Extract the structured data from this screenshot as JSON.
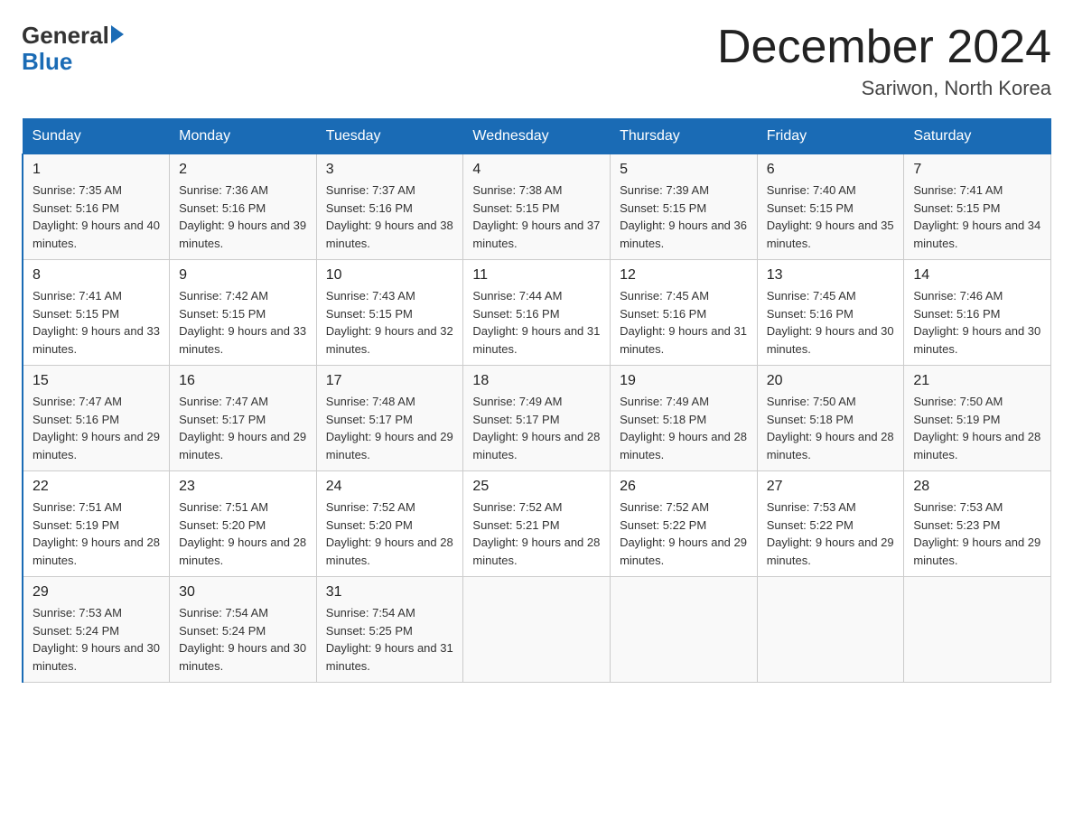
{
  "header": {
    "title": "December 2024",
    "location": "Sariwon, North Korea",
    "logo_general": "General",
    "logo_blue": "Blue"
  },
  "days_of_week": [
    "Sunday",
    "Monday",
    "Tuesday",
    "Wednesday",
    "Thursday",
    "Friday",
    "Saturday"
  ],
  "weeks": [
    [
      {
        "day": "1",
        "sunrise": "7:35 AM",
        "sunset": "5:16 PM",
        "daylight": "9 hours and 40 minutes."
      },
      {
        "day": "2",
        "sunrise": "7:36 AM",
        "sunset": "5:16 PM",
        "daylight": "9 hours and 39 minutes."
      },
      {
        "day": "3",
        "sunrise": "7:37 AM",
        "sunset": "5:16 PM",
        "daylight": "9 hours and 38 minutes."
      },
      {
        "day": "4",
        "sunrise": "7:38 AM",
        "sunset": "5:15 PM",
        "daylight": "9 hours and 37 minutes."
      },
      {
        "day": "5",
        "sunrise": "7:39 AM",
        "sunset": "5:15 PM",
        "daylight": "9 hours and 36 minutes."
      },
      {
        "day": "6",
        "sunrise": "7:40 AM",
        "sunset": "5:15 PM",
        "daylight": "9 hours and 35 minutes."
      },
      {
        "day": "7",
        "sunrise": "7:41 AM",
        "sunset": "5:15 PM",
        "daylight": "9 hours and 34 minutes."
      }
    ],
    [
      {
        "day": "8",
        "sunrise": "7:41 AM",
        "sunset": "5:15 PM",
        "daylight": "9 hours and 33 minutes."
      },
      {
        "day": "9",
        "sunrise": "7:42 AM",
        "sunset": "5:15 PM",
        "daylight": "9 hours and 33 minutes."
      },
      {
        "day": "10",
        "sunrise": "7:43 AM",
        "sunset": "5:15 PM",
        "daylight": "9 hours and 32 minutes."
      },
      {
        "day": "11",
        "sunrise": "7:44 AM",
        "sunset": "5:16 PM",
        "daylight": "9 hours and 31 minutes."
      },
      {
        "day": "12",
        "sunrise": "7:45 AM",
        "sunset": "5:16 PM",
        "daylight": "9 hours and 31 minutes."
      },
      {
        "day": "13",
        "sunrise": "7:45 AM",
        "sunset": "5:16 PM",
        "daylight": "9 hours and 30 minutes."
      },
      {
        "day": "14",
        "sunrise": "7:46 AM",
        "sunset": "5:16 PM",
        "daylight": "9 hours and 30 minutes."
      }
    ],
    [
      {
        "day": "15",
        "sunrise": "7:47 AM",
        "sunset": "5:16 PM",
        "daylight": "9 hours and 29 minutes."
      },
      {
        "day": "16",
        "sunrise": "7:47 AM",
        "sunset": "5:17 PM",
        "daylight": "9 hours and 29 minutes."
      },
      {
        "day": "17",
        "sunrise": "7:48 AM",
        "sunset": "5:17 PM",
        "daylight": "9 hours and 29 minutes."
      },
      {
        "day": "18",
        "sunrise": "7:49 AM",
        "sunset": "5:17 PM",
        "daylight": "9 hours and 28 minutes."
      },
      {
        "day": "19",
        "sunrise": "7:49 AM",
        "sunset": "5:18 PM",
        "daylight": "9 hours and 28 minutes."
      },
      {
        "day": "20",
        "sunrise": "7:50 AM",
        "sunset": "5:18 PM",
        "daylight": "9 hours and 28 minutes."
      },
      {
        "day": "21",
        "sunrise": "7:50 AM",
        "sunset": "5:19 PM",
        "daylight": "9 hours and 28 minutes."
      }
    ],
    [
      {
        "day": "22",
        "sunrise": "7:51 AM",
        "sunset": "5:19 PM",
        "daylight": "9 hours and 28 minutes."
      },
      {
        "day": "23",
        "sunrise": "7:51 AM",
        "sunset": "5:20 PM",
        "daylight": "9 hours and 28 minutes."
      },
      {
        "day": "24",
        "sunrise": "7:52 AM",
        "sunset": "5:20 PM",
        "daylight": "9 hours and 28 minutes."
      },
      {
        "day": "25",
        "sunrise": "7:52 AM",
        "sunset": "5:21 PM",
        "daylight": "9 hours and 28 minutes."
      },
      {
        "day": "26",
        "sunrise": "7:52 AM",
        "sunset": "5:22 PM",
        "daylight": "9 hours and 29 minutes."
      },
      {
        "day": "27",
        "sunrise": "7:53 AM",
        "sunset": "5:22 PM",
        "daylight": "9 hours and 29 minutes."
      },
      {
        "day": "28",
        "sunrise": "7:53 AM",
        "sunset": "5:23 PM",
        "daylight": "9 hours and 29 minutes."
      }
    ],
    [
      {
        "day": "29",
        "sunrise": "7:53 AM",
        "sunset": "5:24 PM",
        "daylight": "9 hours and 30 minutes."
      },
      {
        "day": "30",
        "sunrise": "7:54 AM",
        "sunset": "5:24 PM",
        "daylight": "9 hours and 30 minutes."
      },
      {
        "day": "31",
        "sunrise": "7:54 AM",
        "sunset": "5:25 PM",
        "daylight": "9 hours and 31 minutes."
      },
      null,
      null,
      null,
      null
    ]
  ]
}
